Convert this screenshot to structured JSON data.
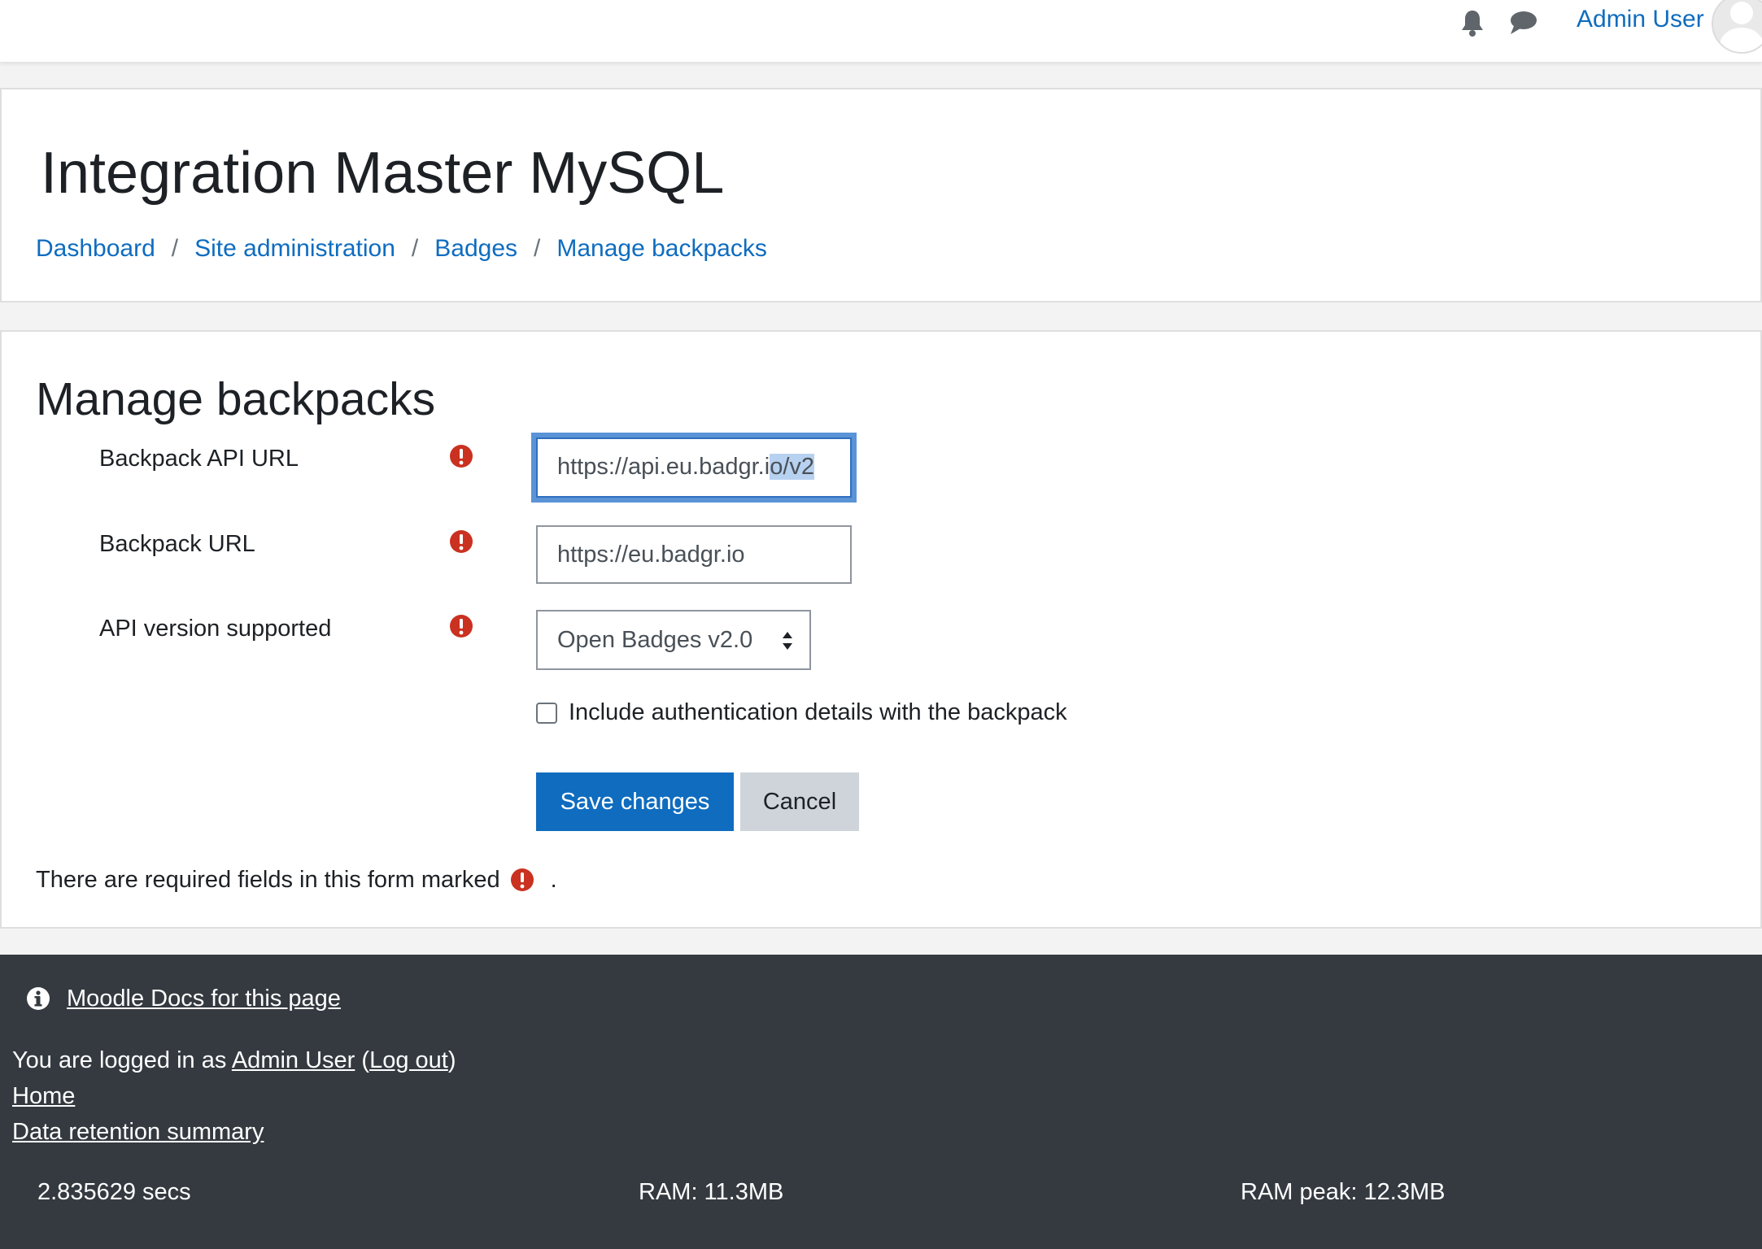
{
  "navbar": {
    "user_name": "Admin User",
    "icons": [
      "bell-icon",
      "chat-icon",
      "avatar"
    ]
  },
  "header": {
    "site_title": "Integration Master MySQL",
    "breadcrumb": [
      "Dashboard",
      "Site administration",
      "Badges",
      "Manage backpacks"
    ],
    "separator": "/"
  },
  "main": {
    "heading": "Manage backpacks",
    "fields": {
      "api_url": {
        "label": "Backpack API URL",
        "value_plain": "https://api.eu.badgr.i",
        "value_selected": "o/v2"
      },
      "backpack_url": {
        "label": "Backpack URL",
        "value": "https://eu.badgr.io"
      },
      "api_version": {
        "label": "API version supported",
        "selected": "Open Badges v2.0"
      },
      "include_auth": {
        "label": "Include authentication details with the backpack",
        "checked": false
      }
    },
    "buttons": {
      "save": "Save changes",
      "cancel": "Cancel"
    },
    "required_note": "There are required fields in this form marked",
    "required_note_end": "."
  },
  "footer": {
    "docs_link": "Moodle Docs for this page",
    "logged_in_prefix": "You are logged in as",
    "logged_in_user": "Admin User",
    "logout_open": "(",
    "logout": "Log out",
    "logout_close": ")",
    "home": "Home",
    "data_retention": "Data retention summary",
    "perf": {
      "secs": "2.835629 secs",
      "ram": "RAM: 11.3MB",
      "ram_peak": "RAM peak: 12.3MB"
    }
  },
  "colors": {
    "link": "#0f6cbf",
    "required": "#ca3120",
    "footer_bg": "#343a40",
    "primary_button": "#0f6cbf",
    "secondary_button": "#ced4da"
  }
}
